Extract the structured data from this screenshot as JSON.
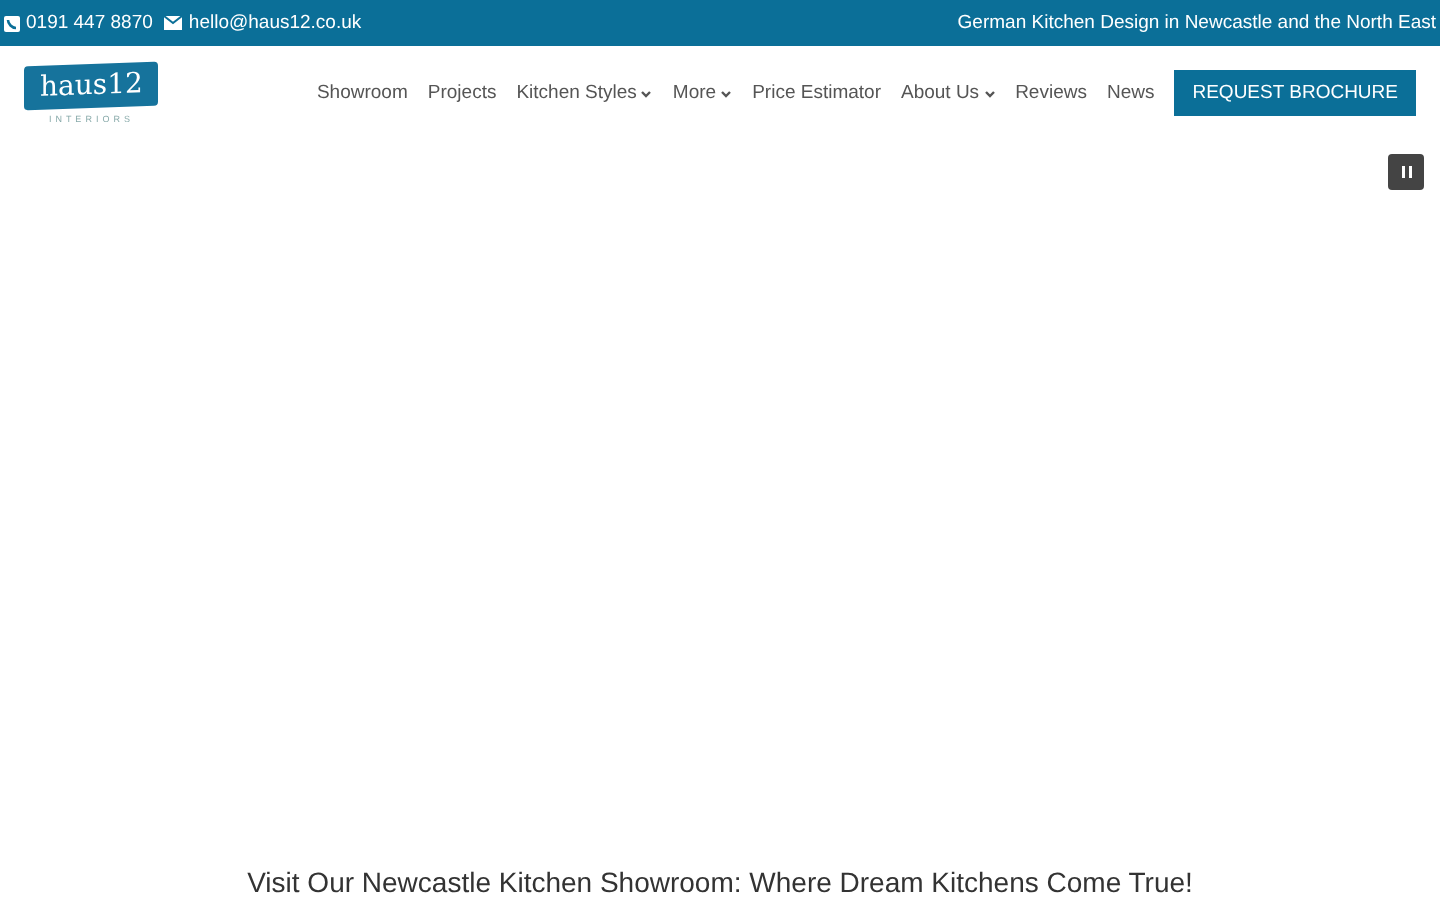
{
  "top_bar": {
    "phone": "0191 447 8870",
    "email": "hello@haus12.co.uk",
    "tagline": "German Kitchen Design in Newcastle and the North East"
  },
  "logo": {
    "name": "haus12",
    "subtitle": "INTERIORS"
  },
  "nav": [
    {
      "label": "Showroom",
      "dropdown": false
    },
    {
      "label": "Projects",
      "dropdown": false
    },
    {
      "label": "Kitchen Styles",
      "dropdown": true
    },
    {
      "label": "More",
      "dropdown": true
    },
    {
      "label": "Price Estimator",
      "dropdown": false
    },
    {
      "label": "About Us",
      "dropdown": true
    },
    {
      "label": "Reviews",
      "dropdown": false
    },
    {
      "label": "News",
      "dropdown": false
    }
  ],
  "cta": "REQUEST BROCHURE",
  "slider": {
    "paused": false
  },
  "heading": "Visit Our Newcastle Kitchen Showroom: Where Dream Kitchens Come True!"
}
